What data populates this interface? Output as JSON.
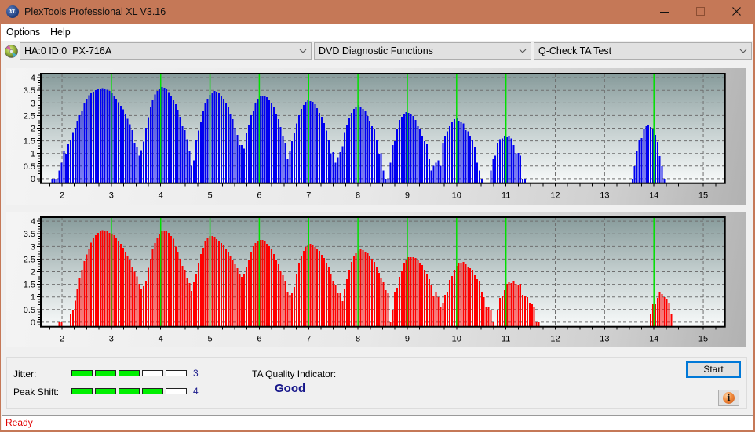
{
  "window": {
    "title": "PlexTools Professional XL V3.16",
    "app_icon": "plextools-xl-logo-icon",
    "app_icon_text": "XL",
    "controls": [
      "minimize-icon",
      "maximize-icon",
      "close-icon"
    ]
  },
  "menu": [
    {
      "label": "Options"
    },
    {
      "label": "Help"
    }
  ],
  "toolbar": {
    "drive_icon": "optical-drive-icon",
    "drive": "HA:0 ID:0  PX-716A",
    "function": "DVD Diagnostic Functions",
    "test": "Q-Check TA Test"
  },
  "results": {
    "jitter": {
      "label": "Jitter:",
      "value": 3,
      "max": 5
    },
    "peak_shift": {
      "label": "Peak Shift:",
      "value": 4,
      "max": 5
    },
    "ta_quality": {
      "label": "TA Quality Indicator:",
      "value": "Good"
    },
    "start_label": "Start",
    "info_icon": "info-icon",
    "info_glyph": "i"
  },
  "status": {
    "text": "Ready"
  },
  "colors": {
    "title_bar": "#c57857",
    "meter_fill": "#00f000",
    "quality_text": "#16168a",
    "status_text": "#e00000",
    "marker": "#00e000",
    "series_blue": "#0000f0",
    "series_red": "#ff0000"
  },
  "chart_data": [
    {
      "type": "bar",
      "title": "",
      "xlabel": "",
      "ylabel": "",
      "xlim": [
        1.57,
        15.44
      ],
      "ylim": [
        -0.18,
        4.16
      ],
      "grid": true,
      "xticks": [
        2,
        3,
        4,
        5,
        6,
        7,
        8,
        9,
        10,
        11,
        12,
        13,
        14,
        15
      ],
      "xtick_labels": [
        "2",
        "3",
        "4",
        "5",
        "6",
        "7",
        "8",
        "9",
        "10",
        "11",
        "12",
        "13",
        "14",
        "15"
      ],
      "yticks": [
        0,
        0.5,
        1,
        1.5,
        2,
        2.5,
        3,
        3.5,
        4
      ],
      "ytick_labels": [
        "0",
        "0.5",
        "1",
        "1.5",
        "2",
        "2.5",
        "3",
        "3.5",
        "4"
      ],
      "x_minor_step": 0.25,
      "y_minor_step": 0.1,
      "markers": [
        3,
        4,
        5,
        6,
        7,
        8,
        9,
        10,
        11,
        14
      ],
      "series": [
        {
          "color": "#0000f0",
          "x_start": 1.804,
          "x_step": 0.0463,
          "values": [
            0,
            0,
            0,
            0.32,
            0.63,
            1.09,
            0.97,
            1.37,
            1.55,
            1.84,
            2.02,
            2.3,
            2.51,
            2.67,
            2.99,
            3.16,
            3.3,
            3.38,
            3.45,
            3.51,
            3.55,
            3.57,
            3.58,
            3.57,
            3.53,
            3.47,
            3.38,
            3.29,
            3.17,
            3.03,
            2.89,
            2.75,
            2.55,
            2.37,
            2.15,
            1.92,
            1.43,
            1.24,
            0.92,
            1.13,
            1.47,
            2.02,
            2.43,
            2.82,
            3.13,
            3.33,
            3.47,
            3.57,
            3.63,
            3.6,
            3.54,
            3.43,
            3.29,
            3.13,
            2.95,
            2.73,
            2.45,
            2.08,
            1.93,
            1.56,
            1.12,
            0.51,
            0.72,
            1.53,
            1.9,
            2.27,
            2.67,
            2.98,
            3.16,
            3.32,
            3.41,
            3.47,
            3.44,
            3.38,
            3.29,
            3.16,
            2.98,
            2.82,
            2.58,
            2.36,
            2.02,
            1.74,
            1.34,
            1.34,
            1.19,
            1.8,
            2.14,
            2.52,
            2.7,
            3.01,
            3.16,
            3.26,
            3.29,
            3.29,
            3.23,
            3.13,
            2.98,
            2.82,
            2.58,
            2.36,
            2.05,
            1.68,
            1.4,
            0.78,
            1.12,
            1.49,
            1.8,
            2.18,
            2.52,
            2.76,
            2.92,
            3.04,
            3.1,
            3.07,
            3.04,
            2.95,
            2.79,
            2.61,
            2.45,
            2.21,
            1.9,
            1.53,
            1.0,
            1.06,
            0.63,
            0.85,
            1.06,
            1.28,
            1.84,
            2.14,
            2.42,
            2.61,
            2.76,
            2.86,
            2.92,
            2.86,
            2.76,
            2.67,
            2.48,
            2.3,
            2.08,
            1.96,
            1.53,
            0.97,
            1.0,
            0.32,
            0,
            0,
            0.63,
            1.34,
            1.49,
            1.99,
            2.33,
            2.45,
            2.58,
            2.64,
            2.61,
            2.55,
            2.48,
            2.33,
            2.08,
            1.96,
            1.71,
            1.49,
            1.37,
            0.78,
            0.32,
            0.51,
            0.63,
            0.72,
            0.51,
            1.4,
            1.71,
            1.87,
            2.08,
            2.27,
            2.36,
            2.39,
            2.3,
            2.24,
            2.18,
            1.93,
            1.87,
            1.71,
            1.53,
            1.25,
            0.63,
            0.32,
            0,
            null,
            null,
            null,
            0.32,
            0.78,
            0.91,
            1.4,
            1.56,
            1.59,
            1.71,
            1.65,
            1.71,
            1.59,
            1.34,
            1.0,
            1.03,
            0.91,
            0,
            0,
            null,
            null,
            null,
            null,
            null,
            null,
            null,
            null,
            null,
            null,
            null,
            null,
            null,
            null,
            null,
            null,
            null,
            null,
            null,
            null,
            null,
            null,
            null,
            null,
            null,
            null,
            null,
            null,
            null,
            null,
            null,
            null,
            null,
            null,
            null,
            null,
            null,
            null,
            null,
            null,
            null,
            null,
            null,
            null,
            null,
            null,
            0,
            0.5,
            1.09,
            1.52,
            1.61,
            1.98,
            2.08,
            2.14,
            2.05,
            1.98,
            1.74,
            1.46,
            0.9,
            0.5,
            0
          ]
        }
      ]
    },
    {
      "type": "bar",
      "title": "",
      "xlabel": "",
      "ylabel": "",
      "xlim": [
        1.57,
        15.44
      ],
      "ylim": [
        -0.18,
        4.16
      ],
      "grid": true,
      "xticks": [
        2,
        3,
        4,
        5,
        6,
        7,
        8,
        9,
        10,
        11,
        12,
        13,
        14,
        15
      ],
      "xtick_labels": [
        "2",
        "3",
        "4",
        "5",
        "6",
        "7",
        "8",
        "9",
        "10",
        "11",
        "12",
        "13",
        "14",
        "15"
      ],
      "yticks": [
        0,
        0.5,
        1,
        1.5,
        2,
        2.5,
        3,
        3.5,
        4
      ],
      "ytick_labels": [
        "0",
        "0.5",
        "1",
        "1.5",
        "2",
        "2.5",
        "3",
        "3.5",
        "4"
      ],
      "x_minor_step": 0.25,
      "y_minor_step": 0.1,
      "markers": [
        3,
        4,
        5,
        6,
        7,
        8,
        9,
        10,
        11,
        14
      ],
      "series": [
        {
          "color": "#ff0000",
          "x_start": 1.804,
          "x_step": 0.0463,
          "values": [
            null,
            null,
            null,
            0,
            0,
            null,
            null,
            null,
            0.32,
            0.5,
            0.85,
            1.31,
            1.75,
            2.06,
            2.42,
            2.68,
            2.92,
            3.15,
            3.32,
            3.45,
            3.54,
            3.61,
            3.64,
            3.63,
            3.61,
            3.54,
            3.48,
            3.45,
            3.32,
            3.2,
            3.11,
            2.95,
            2.8,
            2.62,
            2.46,
            2.21,
            2.0,
            1.81,
            1.52,
            1.34,
            1.43,
            1.62,
            2.15,
            2.52,
            2.9,
            3.14,
            3.33,
            3.49,
            3.61,
            3.62,
            3.61,
            3.54,
            3.42,
            3.3,
            2.99,
            2.8,
            2.51,
            2.24,
            2.05,
            1.77,
            1.55,
            1.24,
            1.58,
            1.89,
            2.33,
            2.7,
            2.95,
            3.19,
            3.32,
            3.41,
            3.41,
            3.38,
            3.29,
            3.22,
            3.13,
            3.04,
            2.91,
            2.76,
            2.64,
            2.45,
            2.29,
            2.14,
            1.92,
            1.8,
            1.92,
            2.17,
            2.45,
            2.76,
            3.01,
            3.13,
            3.22,
            3.26,
            3.26,
            3.19,
            3.1,
            3.01,
            2.88,
            2.7,
            2.48,
            2.29,
            2.02,
            1.86,
            1.61,
            1.21,
            1.09,
            1.15,
            1.4,
            1.92,
            2.33,
            2.6,
            2.82,
            2.98,
            3.07,
            3.1,
            3.04,
            2.98,
            2.91,
            2.82,
            2.67,
            2.54,
            2.33,
            2.2,
            1.89,
            1.64,
            1.49,
            1.15,
            1.15,
            0.84,
            1.3,
            1.71,
            2.05,
            2.39,
            2.6,
            2.73,
            2.82,
            2.88,
            2.85,
            2.79,
            2.73,
            2.6,
            2.51,
            2.39,
            2.2,
            1.95,
            1.74,
            1.58,
            1.27,
            1.15,
            0,
            0.5,
            1.18,
            1.36,
            1.8,
            2.02,
            2.36,
            2.48,
            2.57,
            2.57,
            2.57,
            2.54,
            2.48,
            2.36,
            2.26,
            2.08,
            1.92,
            1.71,
            1.49,
            1.05,
            1.18,
            0.99,
            0.62,
            0.78,
            1.09,
            1.18,
            1.67,
            1.83,
            2.05,
            2.23,
            2.36,
            2.36,
            2.39,
            2.29,
            2.2,
            2.14,
            2.05,
            1.86,
            1.71,
            1.61,
            1.21,
            0.99,
            0.62,
            0.62,
            0.5,
            0,
            null,
            0.5,
            0.96,
            1.05,
            1.27,
            1.52,
            1.58,
            1.55,
            1.64,
            1.52,
            1.46,
            1.52,
            1.09,
            1.05,
            0.99,
            0.74,
            0.71,
            0.62,
            0,
            0,
            null,
            null,
            null,
            null,
            null,
            null,
            null,
            null,
            null,
            null,
            null,
            null,
            null,
            null,
            null,
            null,
            null,
            null,
            null,
            null,
            null,
            null,
            null,
            null,
            null,
            null,
            null,
            null,
            null,
            null,
            null,
            null,
            null,
            null,
            null,
            null,
            null,
            null,
            null,
            null,
            null,
            null,
            null,
            null,
            null,
            null,
            null,
            null,
            0.31,
            0.71,
            0.71,
            0.96,
            1.18,
            1.12,
            0.99,
            0.9,
            0.78,
            0.31
          ]
        }
      ]
    }
  ]
}
